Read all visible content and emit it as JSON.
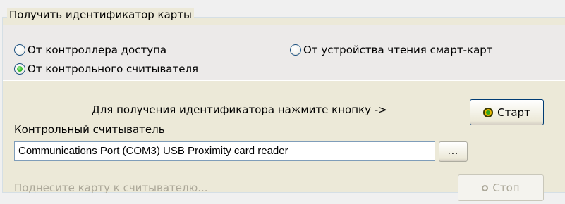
{
  "group": {
    "title": "Получить идентификатор карты"
  },
  "source": {
    "options": [
      {
        "label": "От контроллера доступа",
        "checked": false
      },
      {
        "label": "От устройства чтения смарт-карт",
        "checked": false
      },
      {
        "label": "От контрольного считывателя",
        "checked": true
      }
    ]
  },
  "reader": {
    "hint": "Для получения идентификатора нажмите кнопку ->",
    "start_label": "Старт",
    "field_label": "Контрольный считыватель",
    "field_value": "Communications Port (COM3) USB Proximity card reader",
    "browse_label": "...",
    "status": "Поднесите карту к считывателю...",
    "stop_label": "Стоп"
  },
  "icons": {
    "start": "start-icon",
    "stop": "stop-icon"
  },
  "colors": {
    "window_bg": "#ece9d8",
    "radio_checked": "#3fbf2e",
    "disabled_text": "#aca899",
    "input_border": "#7f9db9"
  }
}
